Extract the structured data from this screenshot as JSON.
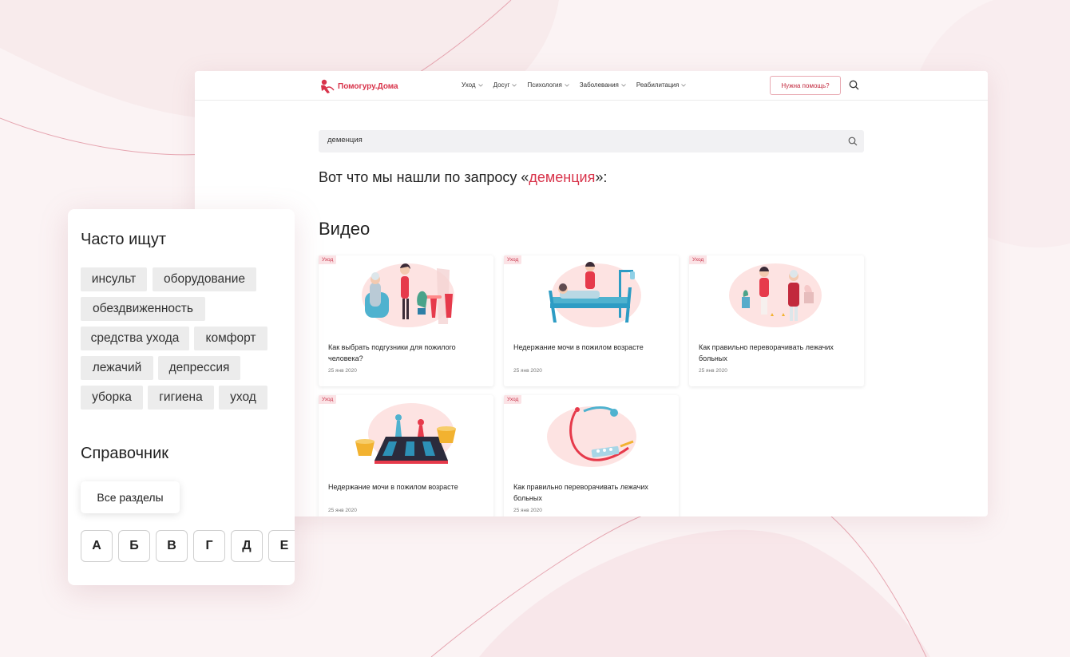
{
  "header": {
    "logo_text": "Помогуру.Дома",
    "nav": [
      "Уход",
      "Досуг",
      "Психология",
      "Заболевания",
      "Реабилитация"
    ],
    "help_button": "Нужна помощь?"
  },
  "search": {
    "value": "деменция"
  },
  "results": {
    "prefix": "Вот что мы нашли по запросу «",
    "query": "деменция",
    "suffix": "»:"
  },
  "section_video": "Видео",
  "cards": [
    {
      "tag": "Уход",
      "title": "Как выбрать подгузники для пожилого человека?",
      "date": "25 янв 2020",
      "illustration": "caregiver-and-elder-illustration"
    },
    {
      "tag": "Уход",
      "title": "Недержание мочи в пожилом возрасте",
      "date": "25 янв 2020",
      "illustration": "hospital-bed-illustration"
    },
    {
      "tag": "Уход",
      "title": "Как правильно переворачивать лежачих больных",
      "date": "25 янв 2020",
      "illustration": "walking-elder-illustration"
    },
    {
      "tag": "Уход",
      "title": "Недержание мочи в пожилом возрасте",
      "date": "25 янв 2020",
      "illustration": "chess-and-tea-illustration"
    },
    {
      "tag": "Уход",
      "title": "Как правильно переворачивать лежачих больных",
      "date": "25 янв 2020",
      "illustration": "stethoscope-illustration"
    }
  ],
  "panel": {
    "popular_title": "Часто ищут",
    "chips": [
      "инсульт",
      "оборудование",
      "обездвиженность",
      "средства ухода",
      "комфорт",
      "лежачий",
      "депрессия",
      "уборка",
      "гигиена",
      "уход"
    ],
    "reference_title": "Справочник",
    "all_sections": "Все разделы",
    "letters": [
      "А",
      "Б",
      "В",
      "Г",
      "Д",
      "Е"
    ]
  },
  "colors": {
    "accent": "#d8334a",
    "background": "#fbf3f4",
    "chip": "#ececec"
  }
}
